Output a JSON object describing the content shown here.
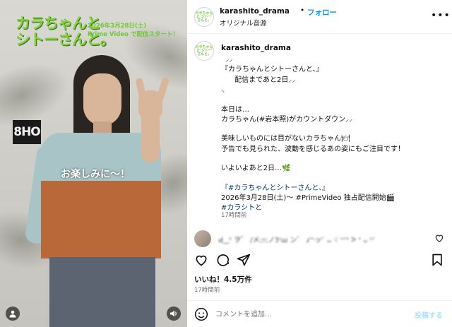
{
  "media": {
    "logo_line1": "カラちゃんと",
    "logo_line2": "シトーさんと。",
    "promo_date": "2026年3月28日(土)",
    "promo_sub": "Prime Video で配信スタート！",
    "shop_sign": "8HO",
    "caption_overlay": "お楽しみに〜！",
    "user_icon": "user-icon",
    "sound_icon": "speaker-icon"
  },
  "header": {
    "username": "karashito_drama",
    "dot": "•",
    "follow_label": "フォロー",
    "audio_label": "オリジナル音源",
    "more_icon": "more-horizontal-icon"
  },
  "avatar_text": "カラちゃんと シトーさんと。",
  "post": {
    "username": "karashito_drama",
    "lines": [
      {
        "text": "  ⸝⸝",
        "type": "text"
      },
      {
        "text": "『カラちゃんとシトーさんと、』",
        "type": "text"
      },
      {
        "text": "      配信まであと2日⸝⸝",
        "type": "text"
      },
      {
        "text": "⸜",
        "type": "text"
      },
      {
        "text": "",
        "type": "blank"
      },
      {
        "text": "本日は…",
        "type": "text"
      },
      {
        "text": "カラちゃん(#岩本照)がカウントダウン⸝⸝",
        "type": "text"
      },
      {
        "text": "",
        "type": "blank"
      },
      {
        "text": "美味しいものには目がないカラちゃん🍽",
        "type": "text"
      },
      {
        "text": "予告でも見られた、波動を感じるあの姿にもご注目です！",
        "type": "text"
      },
      {
        "text": "",
        "type": "blank"
      },
      {
        "text": "いよいよあと2日…🌿",
        "type": "text"
      },
      {
        "text": "",
        "type": "blank"
      },
      {
        "text": "『#カラちゃんとシトーさんと、』",
        "type": "link"
      },
      {
        "text": "2026年3月28日(土)〜 #PrimeVideo 独占配信開始🎬",
        "type": "text"
      },
      {
        "text": "#カラシトと",
        "type": "link"
      }
    ],
    "time": "17時間前"
  },
  "comment": {
    "text": "Ԁ‿ᐢ ヲ゛ /メ;ｯ;ノ̀ɔ'ɯ ン゛ ɹ'ᐩ·ɔᐟᐝ ᴗ ☟ ᐩᐟᐣ ᐷ ᐩ ᴗ ⁽ᐟ"
  },
  "actions": {
    "like_icon": "heart-icon",
    "comment_icon": "comment-bubble-icon",
    "share_icon": "paper-plane-icon",
    "save_icon": "bookmark-icon",
    "likes_label": "いいね！4.5万件",
    "time": "17時間前"
  },
  "composer": {
    "emoji_icon": "smiley-icon",
    "placeholder": "コメントを追加...",
    "post_label": "投稿する"
  },
  "colors": {
    "accent": "#0095f6",
    "brand_green": "#7fd23c",
    "link": "#00376b",
    "muted": "#737373"
  }
}
